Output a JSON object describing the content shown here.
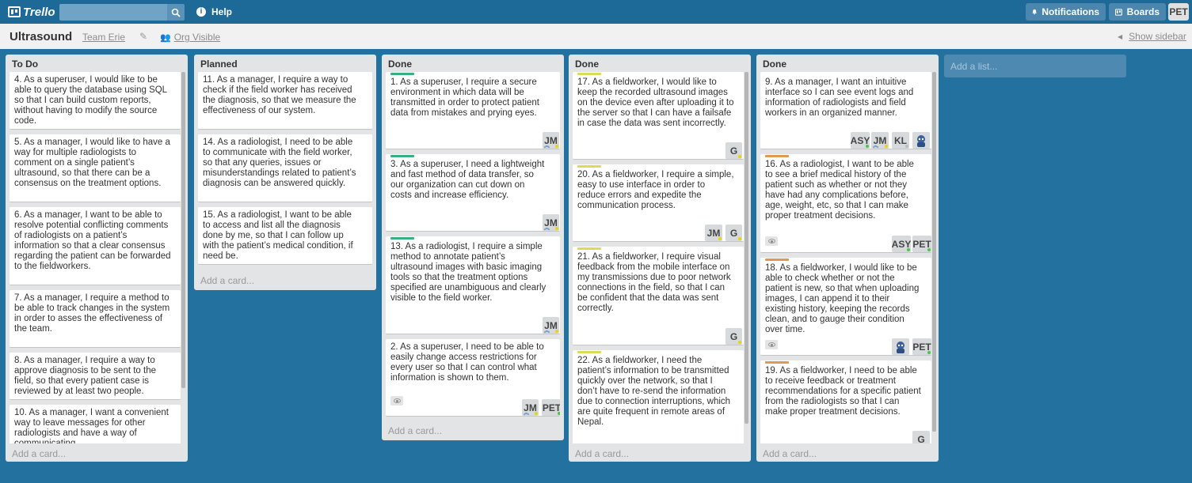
{
  "header": {
    "logo_text": "Trello",
    "search_placeholder": "",
    "help_label": "Help",
    "notifications_label": "Notifications",
    "boards_label": "Boards",
    "user_initials": "PET"
  },
  "board": {
    "title": "Ultrasound",
    "team": "Team Erie",
    "visibility": "Org Visible",
    "show_sidebar": "Show sidebar"
  },
  "add_list_placeholder": "Add a list...",
  "add_card_label": "Add a card...",
  "lists": [
    {
      "title": "To Do",
      "cards": [
        {
          "text": "4. As a superuser, I would like to be able to query the database using SQL so that I can build custom reports, without having to modify the source code."
        },
        {
          "text": "5. As a manager, I would like to have a way for multiple radiologists to comment on a single patient’s ultrasound, so that there can be a consensus on the treatment options."
        },
        {
          "text": "6. As a manager, I want to be able to resolve potential conflicting comments of radiologists on a patient’s information so that a clear consensus regarding the patient can be forwarded to the fieldworkers."
        },
        {
          "text": "7. As a manager, I require a method to be able to track changes in the system in order to asses the effectiveness of the team."
        },
        {
          "text": "8. As a manager, I require a way to approve diagnosis to be sent to the field, so that every patient case is reviewed by at least two people."
        },
        {
          "text": "10. As a manager, I want a convenient way to leave messages for other radiologists and have a way of communicating"
        }
      ]
    },
    {
      "title": "Planned",
      "cards": [
        {
          "text": "11. As a manager, I require a way to check if the field worker has received the diagnosis, so that we measure the effectiveness of our system."
        },
        {
          "text": "14. As a radiologist, I need to be able to communicate with the field worker, so that any queries, issues or misunderstandings related to patient’s diagnosis can be answered quickly."
        },
        {
          "text": "15. As a radiologist, I want to be able to access and list all the diagnosis done by me, so that I can follow up with the patient’s medical condition, if need be."
        }
      ]
    },
    {
      "title": "Done",
      "cards": [
        {
          "text": "1. As a superuser, I require a secure environment in which data will be transmitted in order to protect patient data from mistakes and prying eyes.",
          "label": "green",
          "members": [
            "JM"
          ]
        },
        {
          "text": "3. As a superuser, I need a lightweight and fast method of data transfer, so our organization can cut down on costs and increase efficiency.",
          "label": "green",
          "members": [
            "JM"
          ]
        },
        {
          "text": "13. As a radiologist, I require a simple method to annotate patient’s ultrasound images with basic imaging tools so that the treatment options specified are unambiguous and clearly visible to the field worker.",
          "label": "green",
          "members": [
            "JM"
          ]
        },
        {
          "text": "2. As a superuser, I need to be able to easily change access restrictions for every user so that I can control what information is shown to them.",
          "members": [
            "JM",
            "PET"
          ]
        }
      ]
    },
    {
      "title": "Done",
      "cards": [
        {
          "text": "17. As a fieldworker, I would like to keep the recorded ultrasound images on the device even after uploading it to the server so that I can have a failsafe in case the data was sent incorrectly.",
          "label": "yellow",
          "members": [
            "G"
          ]
        },
        {
          "text": "20. As a fieldworker, I require a simple, easy to use interface in order to reduce errors and expedite the communication process.",
          "label": "yellow",
          "members": [
            "JM",
            "G"
          ]
        },
        {
          "text": "21. As a fieldworker, I require visual feedback from the mobile interface on my transmissions due to poor network connections in the field, so that I can be confident that the data was sent correctly.",
          "label": "yellow",
          "members": [
            "G"
          ]
        },
        {
          "text": "22. As a fieldworker, I need the patient’s information to be transmitted quickly over the network, so that I don’t have to re-send the information due to connection interruptions, which are quite frequent in remote areas of Nepal.",
          "label": "yellow"
        }
      ]
    },
    {
      "title": "Done",
      "cards": [
        {
          "text": "9. As a manager, I want an intuitive interface so I can see event logs and information of radiologists and field workers in an organized manner.",
          "members": [
            "ASY",
            "JM",
            "KL"
          ]
        },
        {
          "text": "16. As a radiologist, I want to be able to see a brief medical history of the patient such as whether or not they have had any complications before, age, weight, etc, so that I can make proper treatment decisions.",
          "label": "orange",
          "members": [
            "ASY",
            "PET"
          ]
        },
        {
          "text": "18. As a fieldworker, I would like to be able to check whether or not the patient is new, so that when uploading images, I can append it to their existing history, keeping the records clean, and to gauge their condition over time.",
          "label": "orange",
          "members": [
            "PET"
          ]
        },
        {
          "text": "19. As a fieldworker, I need to be able to receive feedback or treatment recommendations for a specific patient from the radiologists so that I can make proper treatment decisions.",
          "label": "orange",
          "members": [
            "G"
          ]
        }
      ]
    }
  ]
}
